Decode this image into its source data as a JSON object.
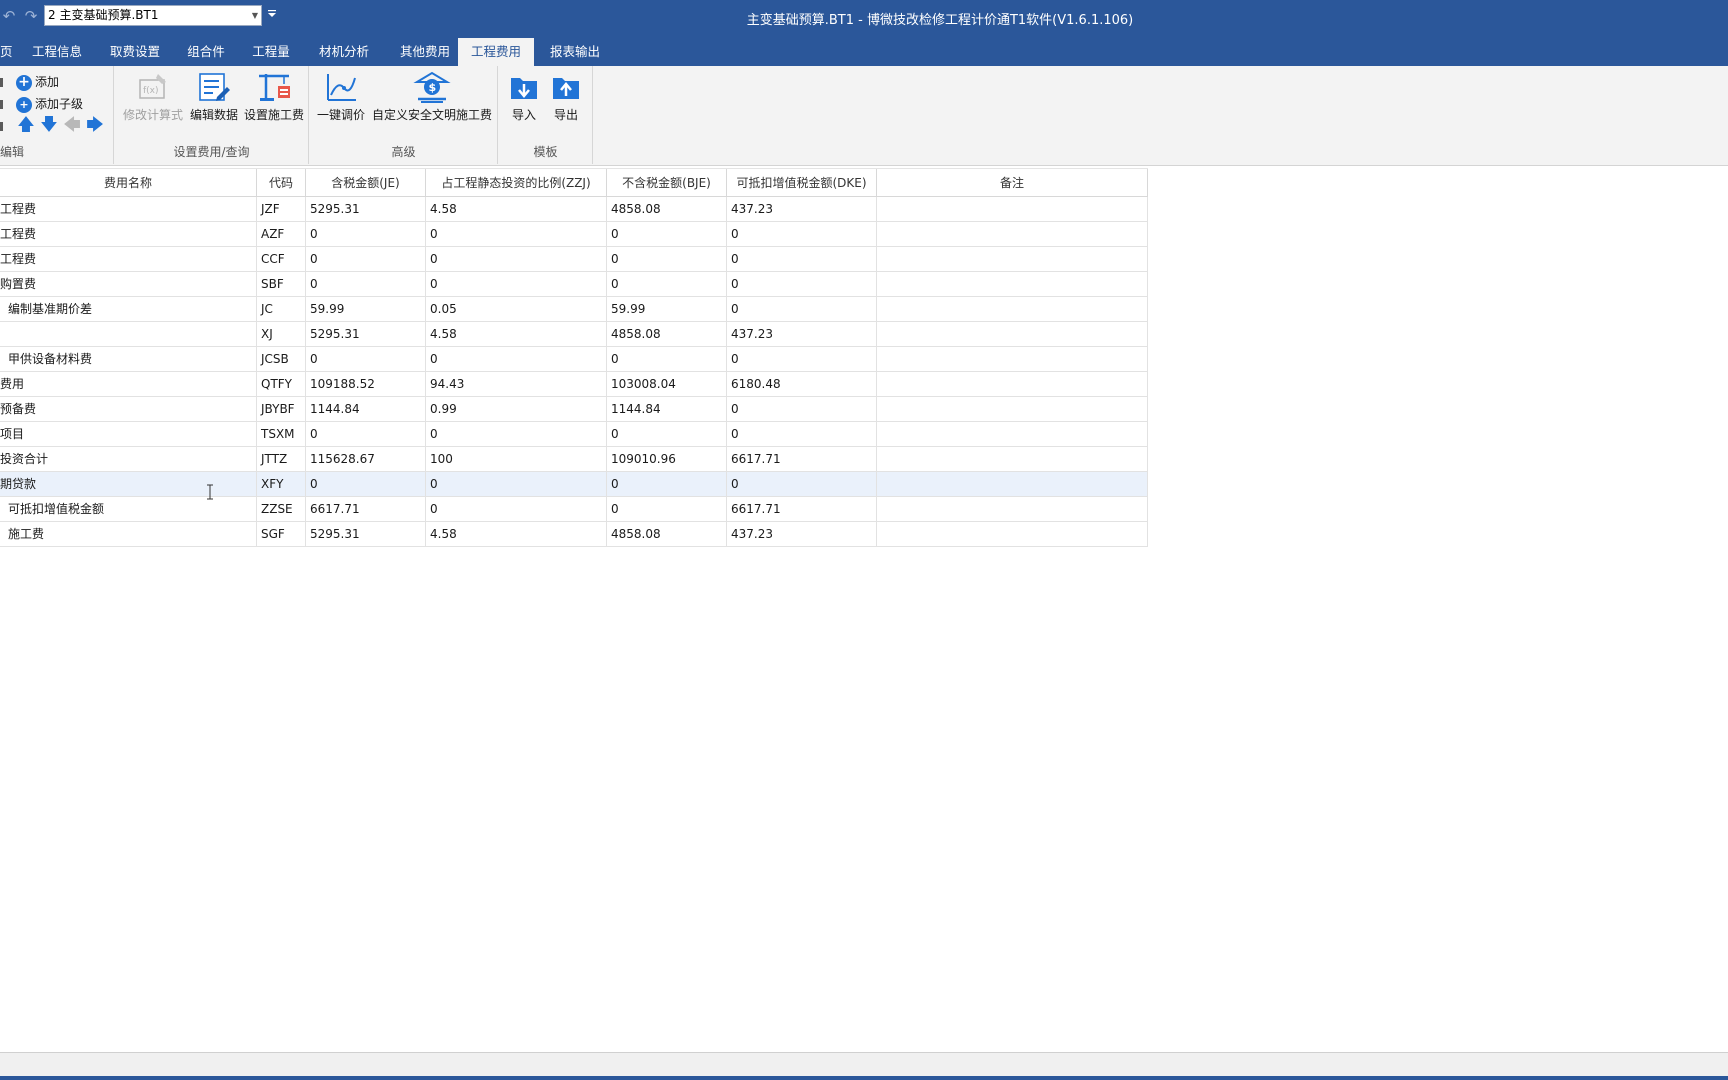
{
  "titlebar": {
    "document_selector": "2 主变基础预算.BT1",
    "app_title": "主变基础预算.BT1 - 博微技改检修工程计价通T1软件(V1.6.1.106)"
  },
  "tabs": [
    {
      "label": "页"
    },
    {
      "label": "工程信息"
    },
    {
      "label": "取费设置"
    },
    {
      "label": "组合件"
    },
    {
      "label": "工程量"
    },
    {
      "label": "材机分析"
    },
    {
      "label": "其他费用"
    },
    {
      "label": "工程费用",
      "active": true
    },
    {
      "label": "报表输出"
    }
  ],
  "ribbon": {
    "edit_group": {
      "label": "编辑",
      "add": "添加",
      "add_child": "添加子级"
    },
    "query_group": {
      "label": "设置费用/查询",
      "modify_formula": "修改计算式",
      "edit_data": "编辑数据",
      "set_construction_fee": "设置施工费"
    },
    "advanced_group": {
      "label": "高级",
      "one_key_adjust": "一键调价",
      "custom_safety_fee": "自定义安全文明施工费"
    },
    "template_group": {
      "label": "模板",
      "import": "导入",
      "export": "导出"
    }
  },
  "table": {
    "columns": [
      "费用名称",
      "代码",
      "含税金额(JE)",
      "占工程静态投资的比例(ZZJ)",
      "不含税金额(BJE)",
      "可抵扣增值税金额(DKE)",
      "备注"
    ],
    "rows": [
      {
        "name": "工程费",
        "code": "JZF",
        "je": "5295.31",
        "zzj": "4.58",
        "bje": "4858.08",
        "dke": "437.23",
        "note": ""
      },
      {
        "name": "工程费",
        "code": "AZF",
        "je": "0",
        "zzj": "0",
        "bje": "0",
        "dke": "0",
        "note": ""
      },
      {
        "name": "工程费",
        "code": "CCF",
        "je": "0",
        "zzj": "0",
        "bje": "0",
        "dke": "0",
        "note": ""
      },
      {
        "name": "购置费",
        "code": "SBF",
        "je": "0",
        "zzj": "0",
        "bje": "0",
        "dke": "0",
        "note": ""
      },
      {
        "name": "编制基准期价差",
        "code": "JC",
        "je": "59.99",
        "zzj": "0.05",
        "bje": "59.99",
        "dke": "0",
        "note": "",
        "indent": true
      },
      {
        "name": "",
        "code": "XJ",
        "je": "5295.31",
        "zzj": "4.58",
        "bje": "4858.08",
        "dke": "437.23",
        "note": ""
      },
      {
        "name": "甲供设备材料费",
        "code": "JCSB",
        "je": "0",
        "zzj": "0",
        "bje": "0",
        "dke": "0",
        "note": "",
        "indent": true
      },
      {
        "name": "费用",
        "code": "QTFY",
        "je": "109188.52",
        "zzj": "94.43",
        "bje": "103008.04",
        "dke": "6180.48",
        "note": ""
      },
      {
        "name": "预备费",
        "code": "JBYBF",
        "je": "1144.84",
        "zzj": "0.99",
        "bje": "1144.84",
        "dke": "0",
        "note": ""
      },
      {
        "name": "项目",
        "code": "TSXM",
        "je": "0",
        "zzj": "0",
        "bje": "0",
        "dke": "0",
        "note": ""
      },
      {
        "name": "投资合计",
        "code": "JTTZ",
        "je": "115628.67",
        "zzj": "100",
        "bje": "109010.96",
        "dke": "6617.71",
        "note": ""
      },
      {
        "name": "期贷款",
        "code": "XFY",
        "je": "0",
        "zzj": "0",
        "bje": "0",
        "dke": "0",
        "note": "",
        "selected": true
      },
      {
        "name": "可抵扣增值税金额",
        "code": "ZZSE",
        "je": "6617.71",
        "zzj": "0",
        "bje": "0",
        "dke": "6617.71",
        "note": "",
        "indent": true
      },
      {
        "name": "施工费",
        "code": "SGF",
        "je": "5295.31",
        "zzj": "4.58",
        "bje": "4858.08",
        "dke": "437.23",
        "note": "",
        "indent": true
      }
    ]
  },
  "colors": {
    "title_bar": "#2b579a",
    "ribbon_bg": "#f3f3f3",
    "accent_blue": "#2174d6",
    "selected_row": "#eaf1fb"
  }
}
